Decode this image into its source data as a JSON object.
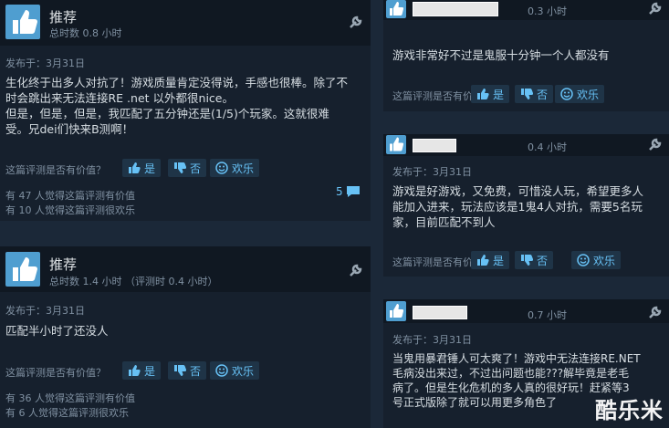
{
  "common": {
    "helpful_question": "这篇评测是否有价值？",
    "yes": "是",
    "no": "否",
    "funny": "欢乐"
  },
  "left_reviews": [
    {
      "recommendation": "推荐",
      "hours": "总时数 0.8 小时",
      "posted": "发布于：3月31日",
      "text_lines": [
        "生化终于出多人对抗了！游戏质量肯定没得说，手感也很棒。除了不",
        "时会跳出来无法连接RE .net 以外都很nice。",
        "但是，但是，但是，我匹配了五分钟还是(1/5)个玩家。这就很难",
        "受。兄dei们快来B测啊！"
      ],
      "helpful_count": "有 47 人觉得这篇评测有价值",
      "funny_count": "有 10 人觉得这篇评测很欢乐",
      "comments": "5"
    },
    {
      "recommendation": "推荐",
      "hours": "总时数 1.4 小时 （评测时 0.4 小时）",
      "posted": "发布于：3月31日",
      "text_lines": [
        "匹配半小时了还没人"
      ],
      "helpful_count": "有 36 人觉得这篇评测有价值",
      "funny_count": "有 6 人觉得这篇评测很欢乐"
    }
  ],
  "right_reviews": [
    {
      "hours": "0.3 小时",
      "text_lines": [
        "游戏非常好不过是鬼服十分钟一个人都没有"
      ]
    },
    {
      "hours": "0.4 小时",
      "posted": "发布于：3月31日",
      "text_lines": [
        "游戏是好游戏，又免费，可惜没人玩，希望更多人",
        "能加入进来，玩法应该是1鬼4人对抗，需要5名玩",
        "家，目前匹配不到人"
      ]
    },
    {
      "hours": "0.7 小时",
      "posted": "发布于：3月31日",
      "text_lines": [
        "当鬼用暴君锤人可太爽了！游戏中无法连接RE.NET",
        "毛病没出来过，不过出问题也能???解毕竟是老毛",
        "病了。但是生化危机的多人真的很好玩！赶紧等3",
        "号正式版除了就可以用更多角色了"
      ]
    }
  ],
  "watermark": "酷乐米",
  "colors": {
    "background": "#1b2838",
    "card": "#16202d",
    "accent_blue": "#67c1f5",
    "thumb_blue": "#4f9ed0"
  }
}
